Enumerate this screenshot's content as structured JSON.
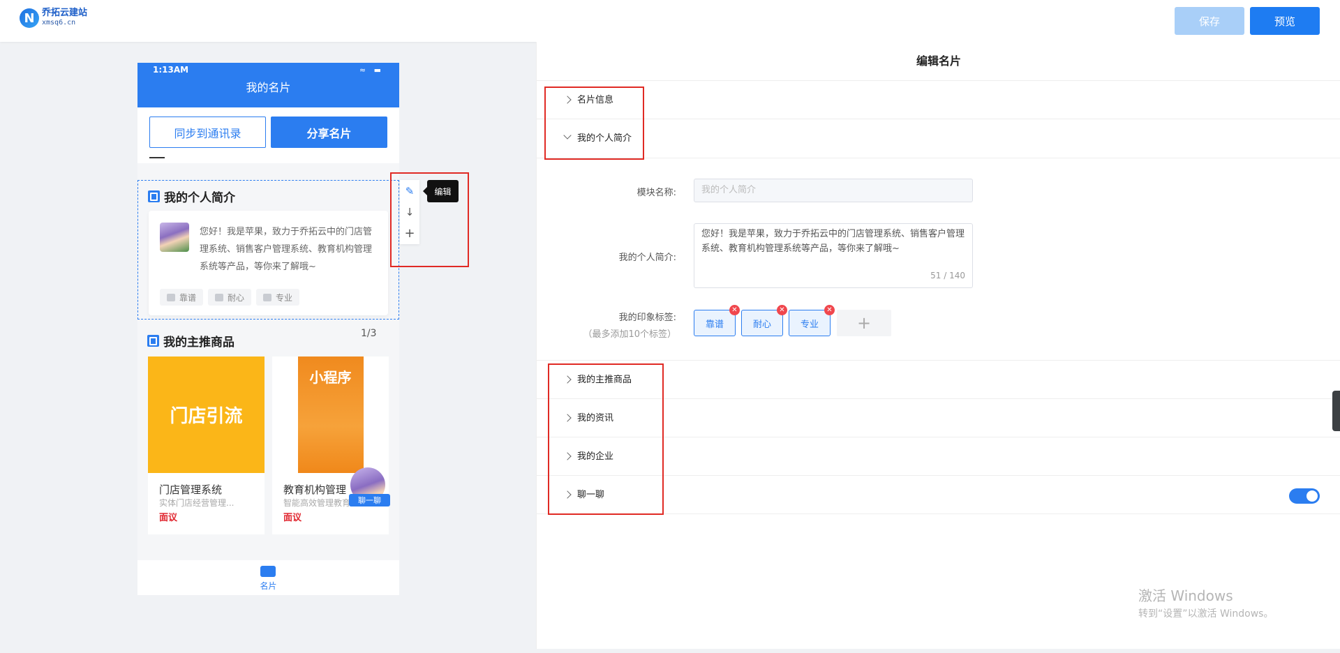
{
  "header": {
    "logo_title": "乔拓云建站",
    "logo_sub": "xmsq6.cn",
    "save_label": "保存",
    "preview_label": "预览"
  },
  "phone": {
    "status_time": "1:13AM",
    "status_icons": "≈ ▬",
    "title": "我的名片",
    "sync_label": "同步到通讯录",
    "share_label": "分享名片",
    "intro": {
      "title": "我的个人简介",
      "text": "您好！我是苹果，致力于乔拓云中的门店管理系统、销售客户管理系统、教育机构管理系统等产品，等你来了解哦~",
      "tags": [
        "靠谱",
        "耐心",
        "专业"
      ]
    },
    "products": {
      "title": "我的主推商品",
      "count": "1/3",
      "items": [
        {
          "image_text": "门店引流",
          "name": "门店管理系统",
          "desc": "实体门店经营管理...",
          "price": "面议"
        },
        {
          "image_text": "小程序",
          "name": "教育机构管理",
          "desc": "智能高效管理教育...",
          "price": "面议"
        }
      ]
    },
    "chat_label": "聊一聊",
    "tab_label": "名片"
  },
  "toolbar": {
    "edit_icon": "✎",
    "down_icon": "↓",
    "add_icon": "+",
    "tooltip": "编辑"
  },
  "editor": {
    "title": "编辑名片",
    "sections": {
      "card_info": "名片信息",
      "intro": "我的个人简介",
      "products": "我的主推商品",
      "news": "我的资讯",
      "company": "我的企业",
      "chat": "聊一聊"
    },
    "form": {
      "module_name_label": "模块名称:",
      "module_name_placeholder": "我的个人简介",
      "intro_label": "我的个人简介:",
      "intro_value": "您好！我是苹果，致力于乔拓云中的门店管理系统、销售客户管理系统、教育机构管理系统等产品，等你来了解哦~",
      "counter": "51 / 140",
      "tags_label": "我的印象标签:",
      "tags_hint": "（最多添加10个标签）",
      "tags": [
        "靠谱",
        "耐心",
        "专业"
      ],
      "add_tag": "+"
    },
    "chat_enabled": true
  },
  "watermark": {
    "title": "激活 Windows",
    "sub": "转到“设置”以激活 Windows。"
  },
  "colors": {
    "accent": "#2b7df0",
    "highlight": "#e02a24",
    "price": "#e0262f"
  }
}
